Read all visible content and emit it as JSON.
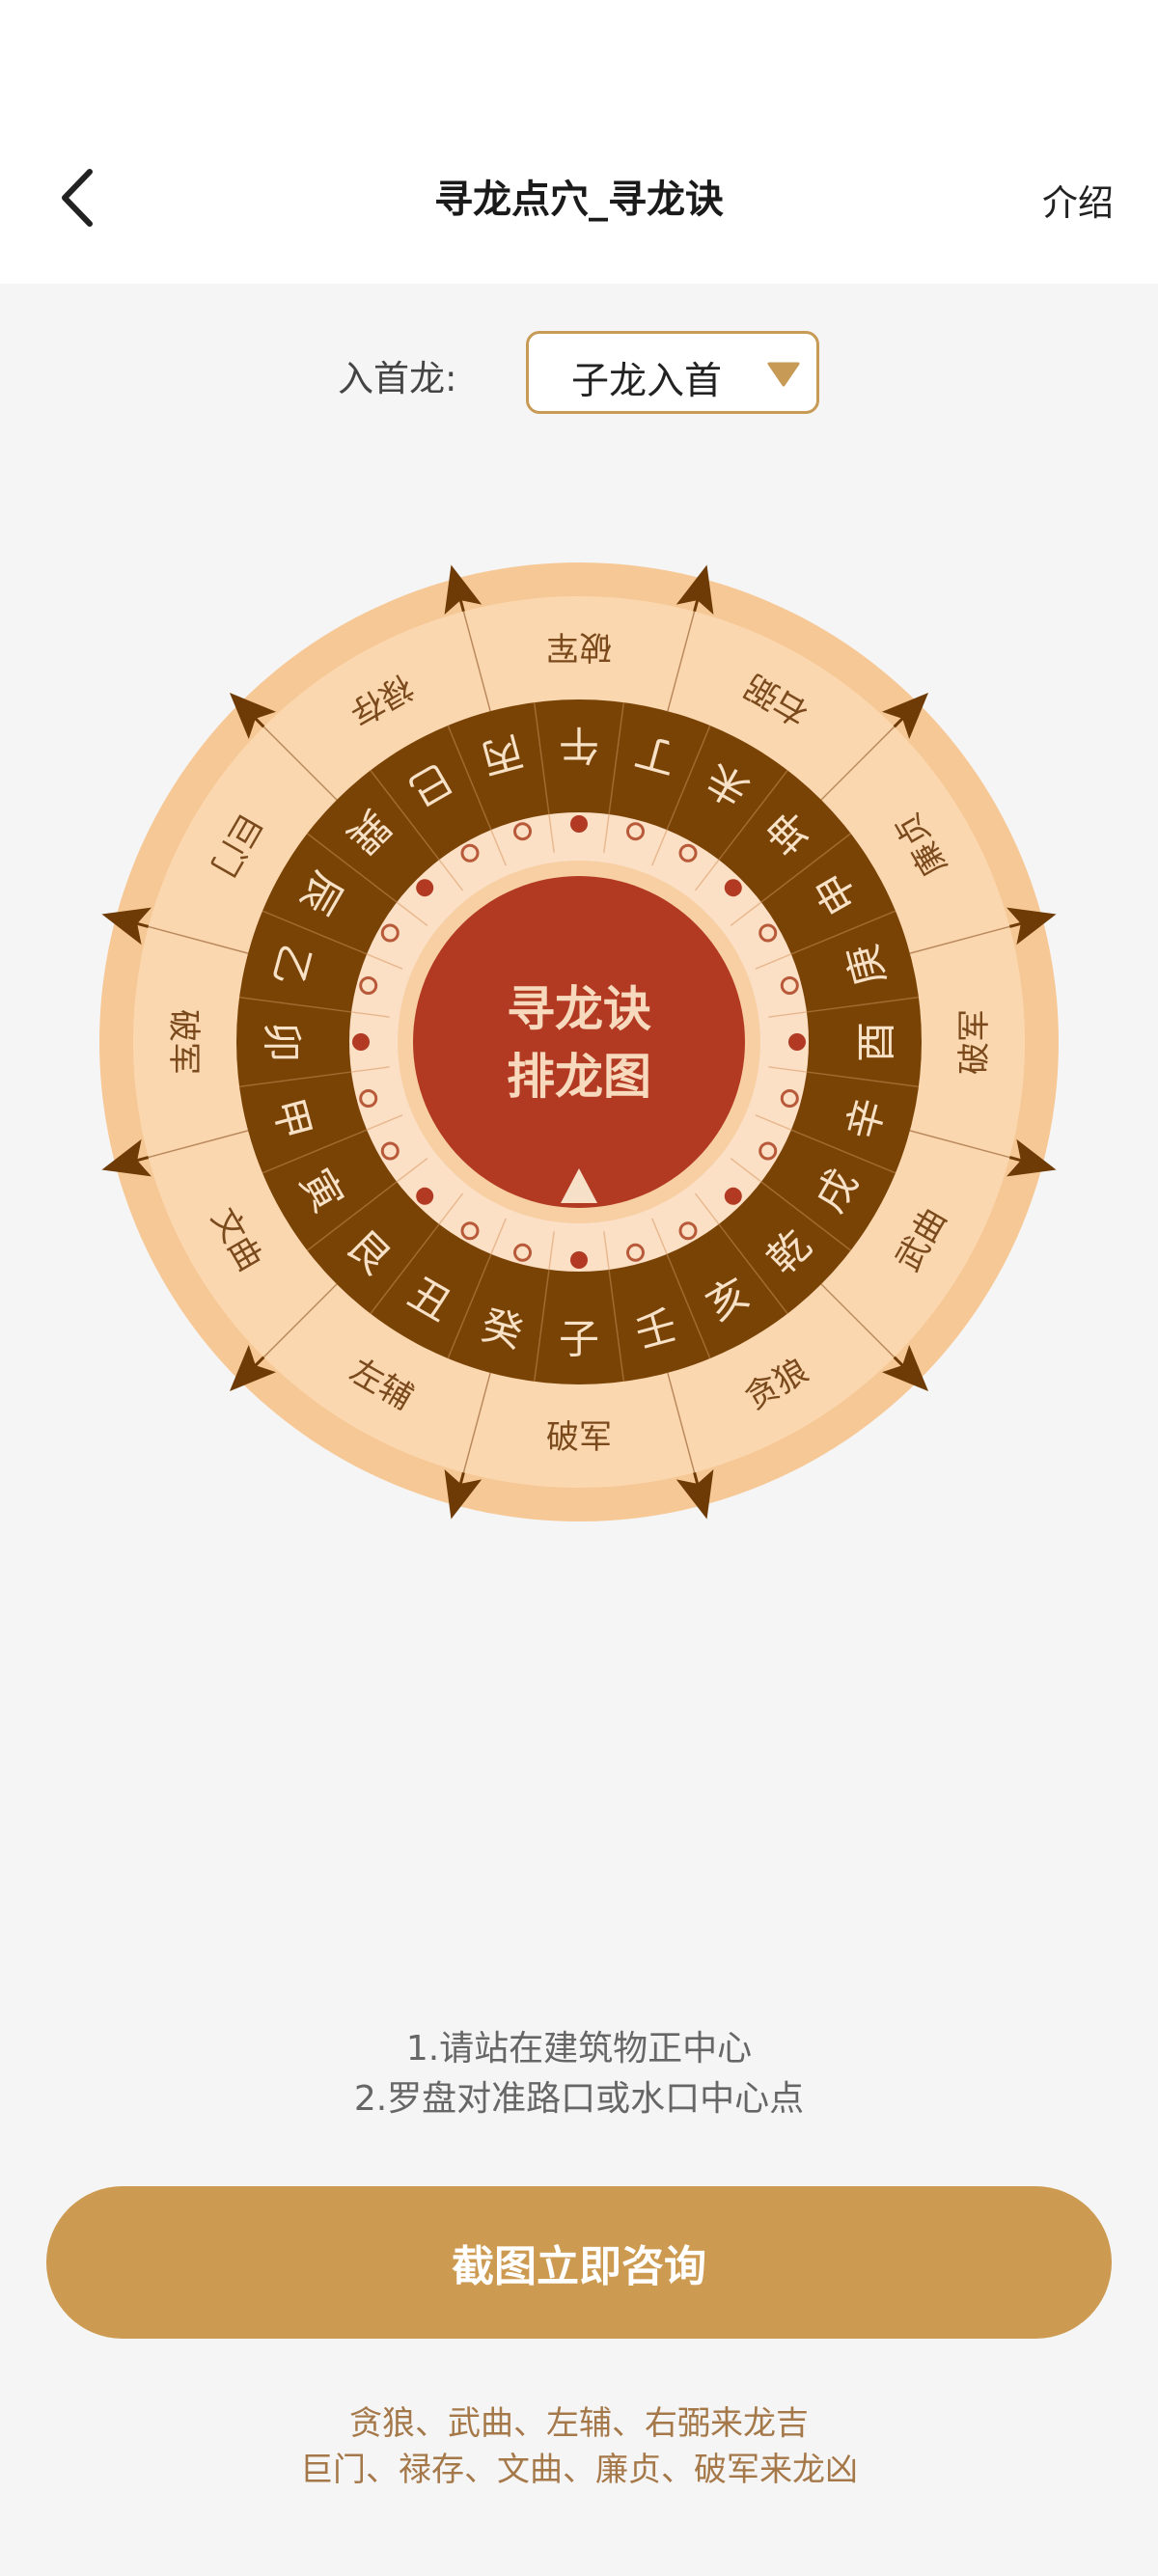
{
  "header": {
    "title": "寻龙点穴_寻龙诀",
    "intro_label": "介绍"
  },
  "picker": {
    "label": "入首龙:",
    "value": "子龙入首"
  },
  "wheel": {
    "center_line1": "寻龙诀",
    "center_line2": "排龙图",
    "mountains": [
      "子",
      "癸",
      "丑",
      "艮",
      "寅",
      "甲",
      "卯",
      "乙",
      "辰",
      "巽",
      "巳",
      "丙",
      "午",
      "丁",
      "未",
      "坤",
      "申",
      "庚",
      "酉",
      "辛",
      "戌",
      "乾",
      "亥",
      "壬"
    ],
    "stars": [
      "破军",
      "左辅",
      "文曲",
      "破军",
      "巨门",
      "禄存",
      "破军",
      "右弼",
      "廉贞",
      "破军",
      "武曲",
      "贪狼"
    ],
    "dot_pattern": [
      "dot",
      "ring",
      "ring",
      "dot",
      "ring",
      "ring",
      "dot",
      "ring",
      "ring",
      "dot",
      "ring",
      "ring",
      "dot",
      "ring",
      "ring",
      "dot",
      "ring",
      "ring",
      "dot",
      "ring",
      "ring",
      "dot",
      "ring",
      "ring"
    ],
    "arrow_count": 12
  },
  "tips": {
    "line1": "1.请站在建筑物正中心",
    "line2": "2.罗盘对准路口或水口中心点"
  },
  "cta": {
    "label": "截图立即咨询"
  },
  "legend": {
    "line1": "贪狼、武曲、左辅、右弼来龙吉",
    "line2": "巨门、禄存、文曲、廉贞、破军来龙凶"
  },
  "colors": {
    "accent": "#cd9a51",
    "outer_ring": "#f6c896",
    "star_ring": "#fbd7b0",
    "mountain_ring": "#7a4306",
    "center": "#b23a22",
    "arrow": "#6e3a05"
  },
  "icons": {
    "back": "chevron-left-icon",
    "dropdown": "triangle-down-icon"
  }
}
